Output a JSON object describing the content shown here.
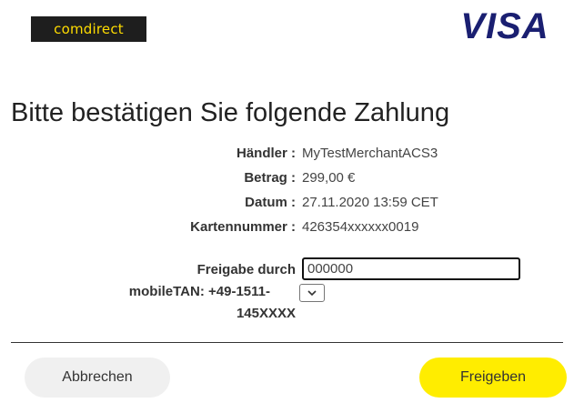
{
  "header": {
    "bank_logo_text": "comdirect",
    "card_brand_logo_text": "VISA"
  },
  "title": "Bitte bestätigen Sie folgende Zahlung",
  "details": [
    {
      "label": "Händler :",
      "value": "MyTestMerchantACS3"
    },
    {
      "label": "Betrag :",
      "value": "299,00 €"
    },
    {
      "label": "Datum :",
      "value": "27.11.2020 13:59 CET"
    },
    {
      "label": "Kartennummer :",
      "value": "426354xxxxxx0019"
    }
  ],
  "tan": {
    "label_line1": "Freigabe durch",
    "label_line2": "mobileTAN: +49-1511-",
    "label_line3": "145XXXX",
    "input_value": "000000",
    "select_icon": "chevron-down-icon"
  },
  "actions": {
    "cancel_label": "Abbrechen",
    "confirm_label": "Freigeben"
  },
  "colors": {
    "confirm_button": "#ffed00",
    "cancel_button": "#f0f0f0",
    "bank_logo_bg": "#1e1e1e",
    "bank_logo_text": "#ffdc00",
    "visa_blue": "#1a1f71"
  }
}
